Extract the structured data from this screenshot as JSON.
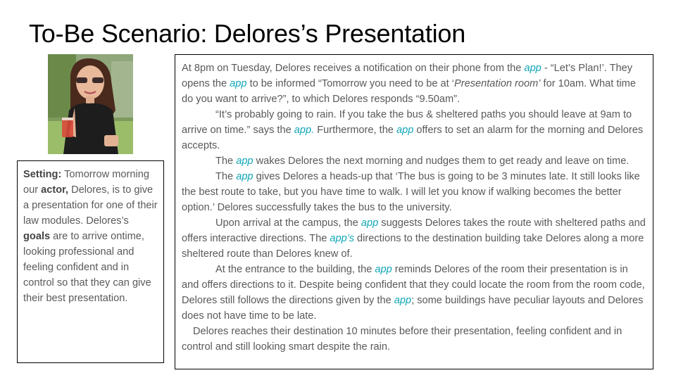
{
  "title": "To-Be Scenario: Delores’s Presentation",
  "setting": {
    "label": "Setting:",
    "t1": " Tomorrow morning our ",
    "actor": "actor,",
    "t2": " Delores, is to give a presentation for one of their law modules. Delores’s ",
    "goals": "goals",
    "t3": " are to arrive ontime, looking professional and feeling confident and in control so that they can give their best presentation."
  },
  "story": {
    "p1": {
      "a": "At 8pm on Tuesday, Delores receives a notification on their phone from the ",
      "app1": "app",
      "b": " - “Let’s Plan!’. They opens the ",
      "app2": "app",
      "c": " to be informed “Tomorrow you need to be at ‘",
      "room": "Presentation room’",
      "d": " for 10am. What time do you want to arrive?”, to which Delores responds “9.50am”."
    },
    "p2": {
      "a": "“It’s probably going to rain. If you take the bus & sheltered paths you should leave at 9am to arrive on time.” says the ",
      "app1": "app.",
      "b": " Furthermore, the ",
      "app2": "app",
      "c": " offers to set an alarm for the morning and Delores accepts."
    },
    "p3": {
      "a": "The ",
      "app1": "app",
      "b": " wakes Delores the next morning and nudges them to get ready and leave on time."
    },
    "p4": {
      "a": "The ",
      "app1": "app",
      "b": " gives Delores a heads-up that ‘The bus is going to be 3 minutes late. It still looks like the best route to take, but you have time to walk. I will let you know if walking becomes the better option.’ Delores successfully takes the bus to the university."
    },
    "p5": {
      "a": "Upon arrival at the campus, the ",
      "app1": "app",
      "b": " suggests Delores takes the route with sheltered paths and offers interactive directions. The ",
      "app2": "app’s",
      "c": " directions to the destination building take Delores along a more sheltered route than Delores knew of."
    },
    "p6": {
      "a": "At the entrance to the building, the ",
      "app1": "app",
      "b": " reminds Delores of the room their presentation is in and offers directions to it. Despite being confident that they could locate the room from the room code, Delores still follows the directions given by the ",
      "app2": "app",
      "c": "; some buildings have peculiar layouts and Delores does not have time to be late."
    },
    "p7": "Delores reaches their destination 10 minutes before their presentation, feeling confident and in control and still looking smart despite the rain."
  },
  "colors": {
    "app_text": "#12a7b8",
    "body_text": "#595959"
  }
}
